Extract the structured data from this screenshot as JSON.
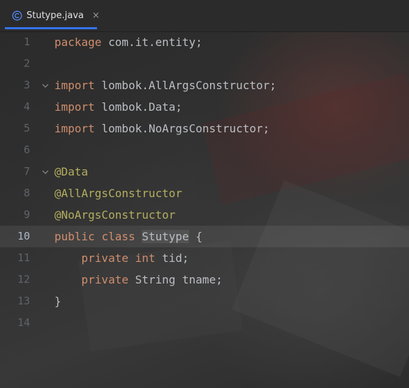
{
  "tab": {
    "file_name": "Stutype.java",
    "close_glyph": "×",
    "icon": "java-class-icon",
    "accent_color": "#3574f0"
  },
  "colors": {
    "keyword": "#cf8e6d",
    "annotation": "#b3ae60",
    "plain": "#bcbec4"
  },
  "code": {
    "current_line": 10,
    "lines": [
      {
        "num": "1",
        "tokens": [
          {
            "t": "package",
            "c": "kw"
          },
          {
            "t": " com.it.entity;",
            "c": "pl"
          }
        ]
      },
      {
        "num": "2",
        "tokens": []
      },
      {
        "num": "3",
        "fold": true,
        "tokens": [
          {
            "t": "import",
            "c": "kw"
          },
          {
            "t": " lombok.AllArgsConstructor;",
            "c": "pl"
          }
        ]
      },
      {
        "num": "4",
        "tokens": [
          {
            "t": "import",
            "c": "kw"
          },
          {
            "t": " lombok.Data;",
            "c": "pl"
          }
        ]
      },
      {
        "num": "5",
        "tokens": [
          {
            "t": "import",
            "c": "kw"
          },
          {
            "t": " lombok.NoArgsConstructor;",
            "c": "pl"
          }
        ]
      },
      {
        "num": "6",
        "tokens": []
      },
      {
        "num": "7",
        "fold": true,
        "tokens": [
          {
            "t": "@Data",
            "c": "ann"
          }
        ]
      },
      {
        "num": "8",
        "tokens": [
          {
            "t": "@AllArgsConstructor",
            "c": "ann"
          }
        ]
      },
      {
        "num": "9",
        "tokens": [
          {
            "t": "@NoArgsConstructor",
            "c": "ann"
          }
        ]
      },
      {
        "num": "10",
        "tokens": [
          {
            "t": "public",
            "c": "kw"
          },
          {
            "t": " ",
            "c": "pl"
          },
          {
            "t": "class",
            "c": "kw"
          },
          {
            "t": " ",
            "c": "pl"
          },
          {
            "t": "Stutype",
            "c": "pl cls-hl"
          },
          {
            "t": " {",
            "c": "pl"
          }
        ]
      },
      {
        "num": "11",
        "tokens": [
          {
            "t": "    ",
            "c": "pl"
          },
          {
            "t": "private",
            "c": "kw"
          },
          {
            "t": " ",
            "c": "pl"
          },
          {
            "t": "int",
            "c": "kw"
          },
          {
            "t": " tid;",
            "c": "pl"
          }
        ]
      },
      {
        "num": "12",
        "tokens": [
          {
            "t": "    ",
            "c": "pl"
          },
          {
            "t": "private",
            "c": "kw"
          },
          {
            "t": " String tname;",
            "c": "pl"
          }
        ]
      },
      {
        "num": "13",
        "tokens": [
          {
            "t": "}",
            "c": "pl"
          }
        ]
      },
      {
        "num": "14",
        "tokens": []
      }
    ]
  }
}
